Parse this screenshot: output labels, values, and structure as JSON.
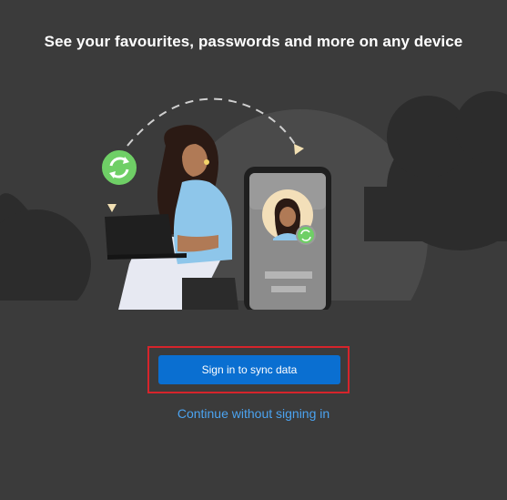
{
  "hero": {
    "title": "See your favourites, passwords and more on any device"
  },
  "actions": {
    "sign_in_label": "Sign in to sync data",
    "continue_label": "Continue without signing in"
  },
  "colors": {
    "background": "#3b3b3b",
    "primary_button": "#0a6fd1",
    "link": "#4ba3f0",
    "highlight_border": "#d6242b",
    "sync_badge": "#6fcf66"
  },
  "icons": {
    "sync": "sync-icon"
  }
}
